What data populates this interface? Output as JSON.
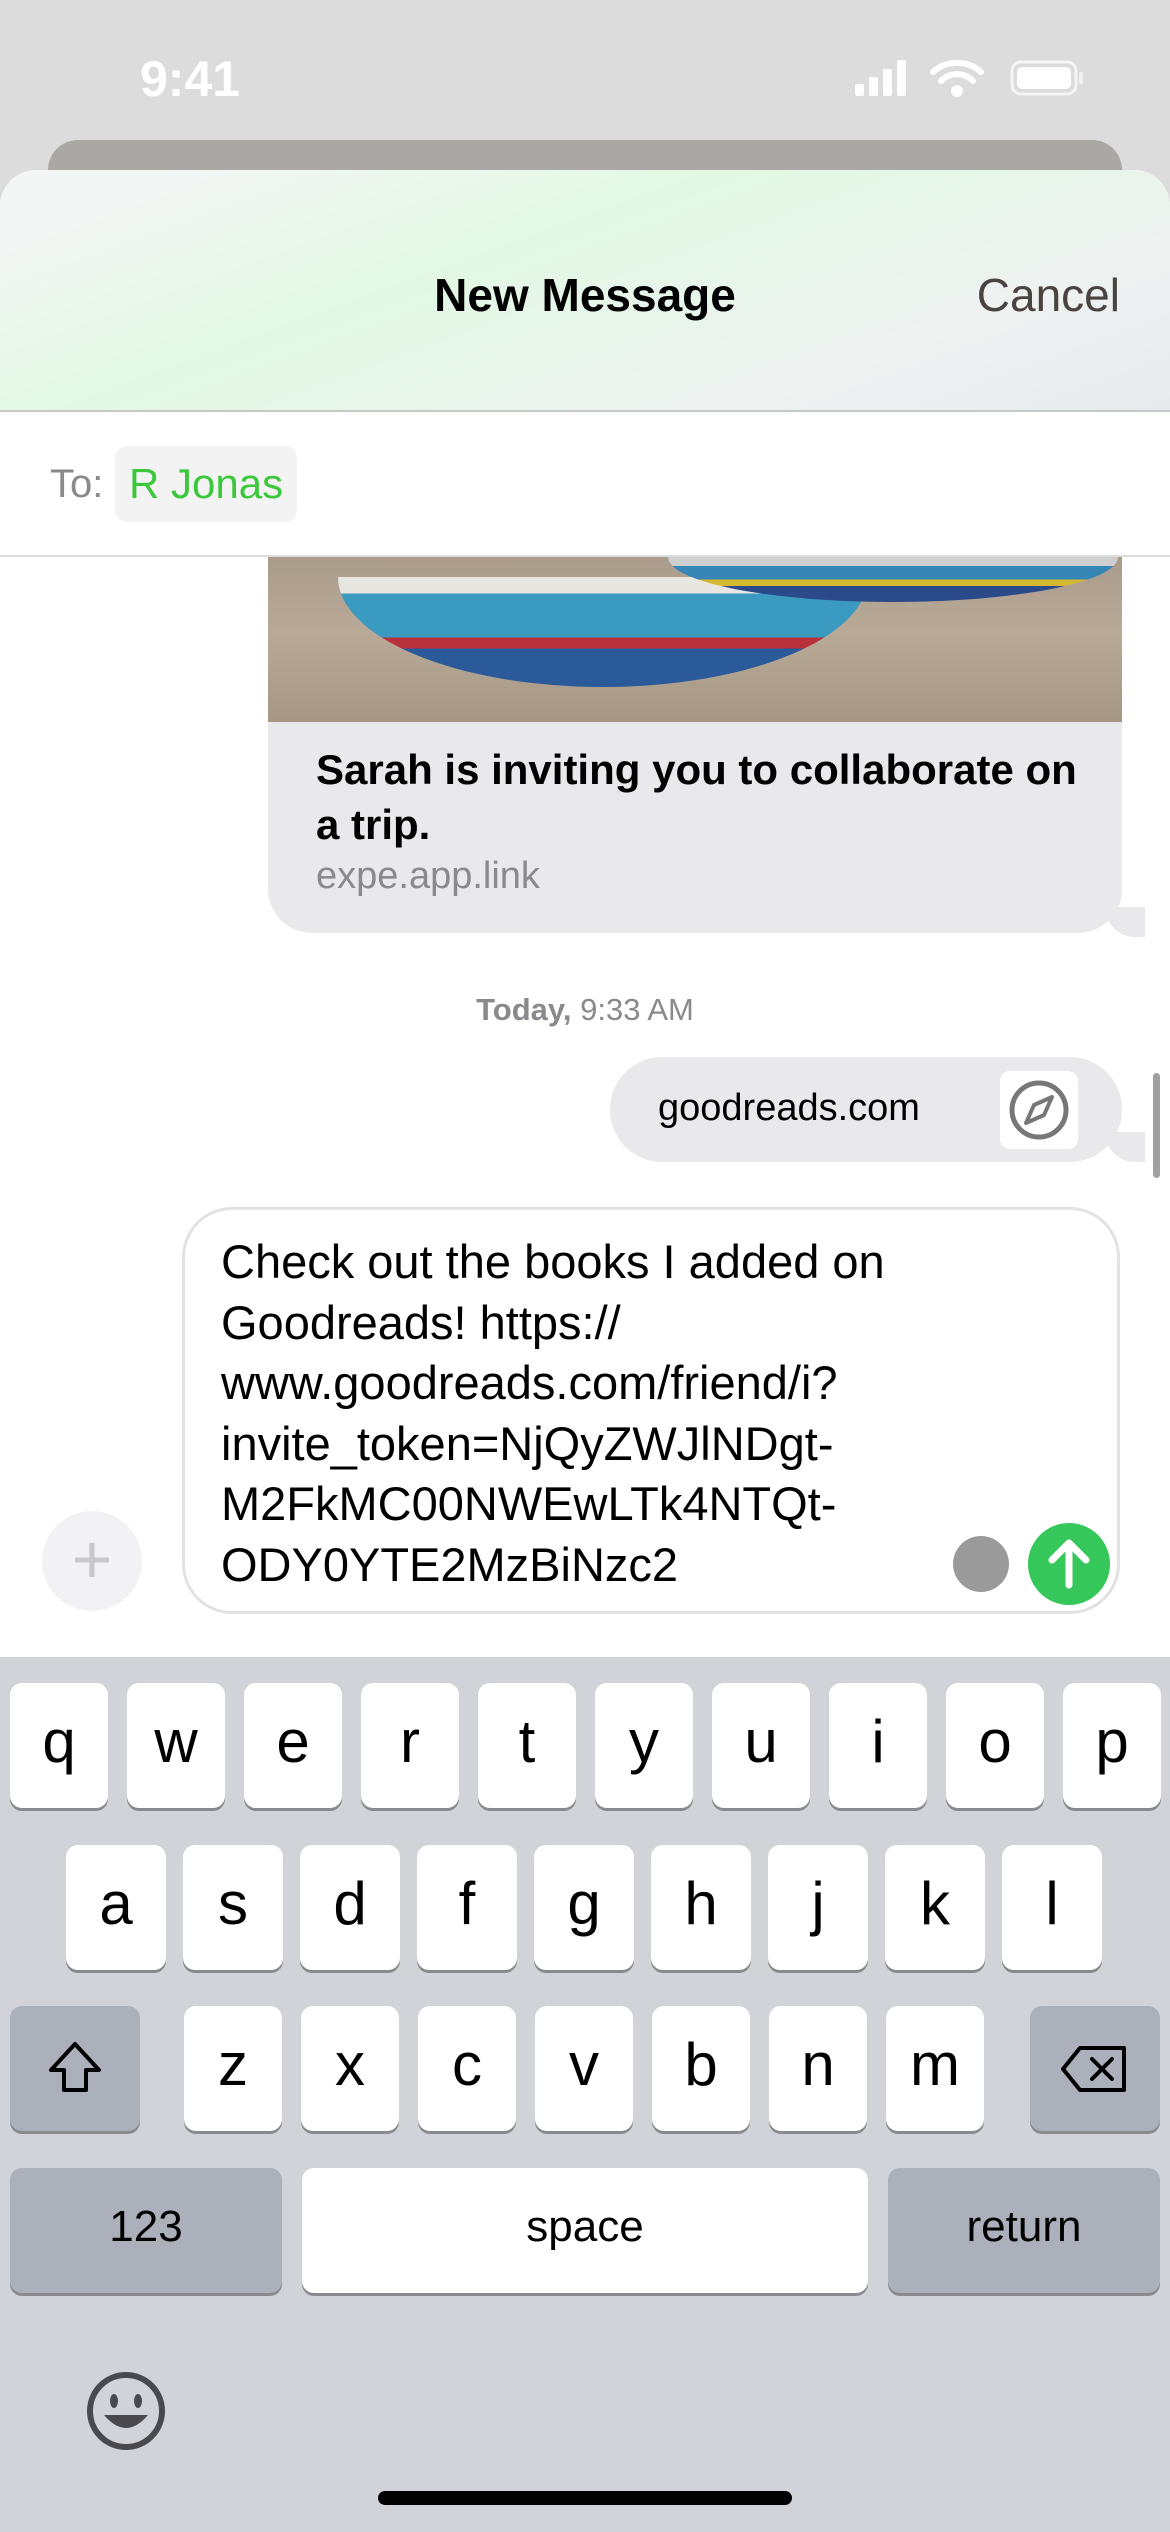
{
  "status_bar": {
    "time": "9:41",
    "icons": [
      "signal-icon",
      "wifi-icon",
      "battery-icon"
    ]
  },
  "header": {
    "title": "New Message",
    "cancel_label": "Cancel"
  },
  "recipient": {
    "label": "To:",
    "name": "R Jonas"
  },
  "messages": [
    {
      "type": "link-preview",
      "title": "Sarah is inviting you to collaborate on a trip.",
      "domain": "expe.app.link"
    },
    {
      "type": "timestamp",
      "day": "Today,",
      "time": "9:33 AM"
    },
    {
      "type": "link",
      "domain": "goodreads.com",
      "icon": "safari-compass-icon"
    }
  ],
  "composer": {
    "text": "Check out the books I added on\nGoodreads! https://\nwww.goodreads.com/friend/i?\ninvite_token=NjQyZWJlNDgt-\nM2FkMC00NWEwLTk4NTQt-\nODY0YTE2MzBiNzc2"
  },
  "keyboard": {
    "row1": [
      "q",
      "w",
      "e",
      "r",
      "t",
      "y",
      "u",
      "i",
      "o",
      "p"
    ],
    "row2": [
      "a",
      "s",
      "d",
      "f",
      "g",
      "h",
      "j",
      "k",
      "l"
    ],
    "row3": [
      "z",
      "x",
      "c",
      "v",
      "b",
      "n",
      "m"
    ],
    "numbers_label": "123",
    "space_label": "space",
    "return_label": "return"
  },
  "colors": {
    "accent": "#36c75a",
    "recipient": "#3cc83c"
  }
}
